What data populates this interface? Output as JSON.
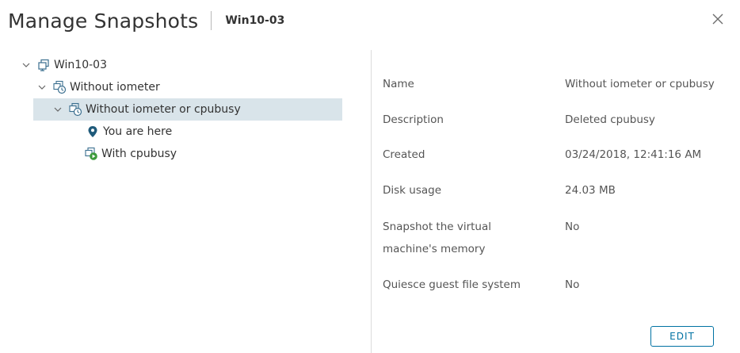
{
  "dialog": {
    "title": "Manage Snapshots",
    "subtitle": "Win10-03",
    "close_icon": "close-icon"
  },
  "tree": {
    "root": {
      "label": "Win10-03",
      "icon": "vm-icon",
      "expanded": true
    },
    "snapshot_1": {
      "label": "Without iometer",
      "icon": "snapshot-icon",
      "expanded": true
    },
    "snapshot_2": {
      "label": "Without iometer or cpubusy",
      "icon": "snapshot-icon",
      "expanded": true,
      "selected": true
    },
    "current_marker": {
      "label": "You are here",
      "icon": "location-pin-icon"
    },
    "snapshot_3": {
      "label": "With cpubusy",
      "icon": "snapshot-running-icon"
    }
  },
  "details": {
    "name": {
      "label": "Name",
      "value": "Without iometer or cpubusy"
    },
    "description": {
      "label": "Description",
      "value": "Deleted cpubusy"
    },
    "created": {
      "label": "Created",
      "value": "03/24/2018, 12:41:16 AM"
    },
    "disk_usage": {
      "label": "Disk usage",
      "value": "24.03 MB"
    },
    "memory": {
      "label_line1": "Snapshot the virtual",
      "label_line2": "machine's memory",
      "value": "No"
    },
    "quiesce": {
      "label": "Quiesce guest file system",
      "value": "No"
    }
  },
  "actions": {
    "edit_label": "EDIT"
  },
  "colors": {
    "accent": "#0072a3",
    "selection": "#d9e4ea",
    "icon_blue": "#3b6f8f",
    "running_green": "#3b9a3b",
    "pin": "#1f5a7a"
  }
}
